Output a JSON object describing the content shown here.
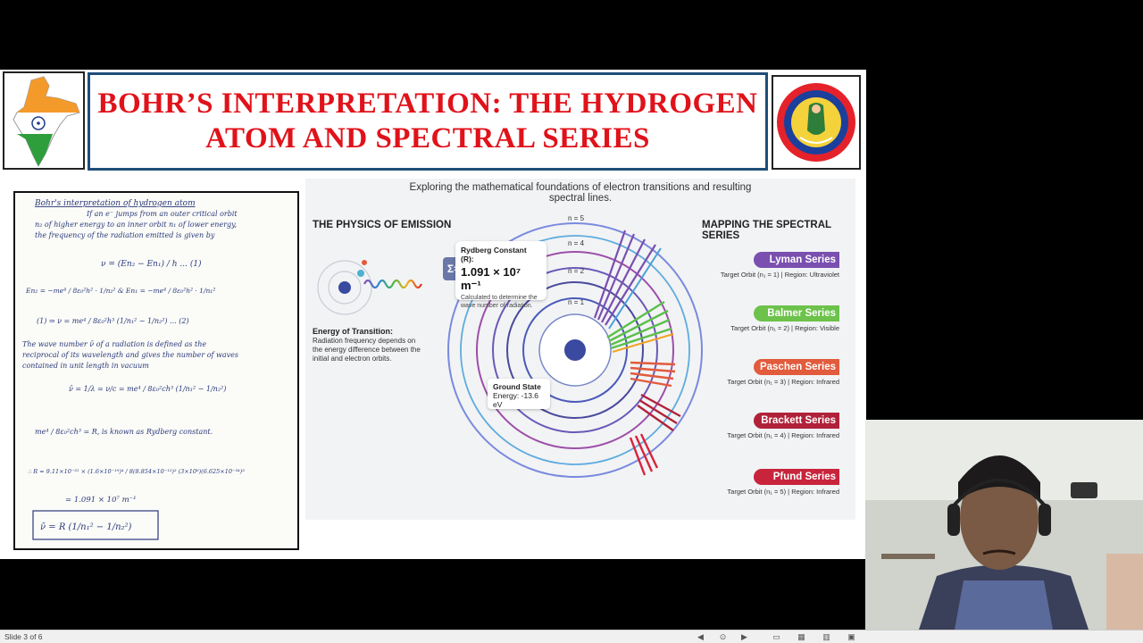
{
  "slide": {
    "title": "BOHR’S INTERPRETATION: THE HYDROGEN ATOM AND SPECTRAL SERIES",
    "title_color": "#e0121a",
    "border_color": "#1f4e79"
  },
  "infographic": {
    "subtitle": "Exploring the mathematical foundations of electron transitions and resulting spectral lines.",
    "physics_title": "THE PHYSICS OF EMISSION",
    "energy_title": "Energy of Transition:",
    "energy_desc": "Radiation frequency depends on the energy difference between the initial and electron orbits.",
    "rydberg_title": "Rydberg Constant (R):",
    "rydberg_value": "1.091 × 10⁷ m⁻¹",
    "rydberg_desc": "Calculated to determine the wave number of radiation.",
    "sigma_symbol": "Σ=",
    "ground_title": "Ground State",
    "ground_energy": "Energy: -13.6 eV",
    "levels": [
      "n = 5",
      "n = 4",
      "n = 2",
      "n = 1"
    ],
    "mapping_title": "MAPPING THE SPECTRAL SERIES",
    "series": [
      {
        "name": "Lyman Series",
        "desc": "Target Orbit (n₁ = 1) | Region: Ultraviolet",
        "color": "#7a4fb0"
      },
      {
        "name": "Balmer Series",
        "desc": "Target Orbit (n₁ = 2) | Region: Visible",
        "color": "#6cc24a"
      },
      {
        "name": "Paschen Series",
        "desc": "Target Orbit (n₁ = 3) | Region: Infrared",
        "color": "#e25b3c"
      },
      {
        "name": "Brackett Series",
        "desc": "Target Orbit (n₁ = 4) | Region: Infrared",
        "color": "#b0223a"
      },
      {
        "name": "Pfund Series",
        "desc": "Target Orbit (n₁ = 5) | Region: Infrared",
        "color": "#c8243c"
      }
    ]
  },
  "notes": {
    "heading": "Bohr's interpretation of hydrogen atom",
    "line1": "If an e⁻ jumps from an outer critical orbit",
    "line2": "n₂ of higher energy to an inner orbit n₁ of lower energy,",
    "line3": "the frequency of the radiation emitted is given by",
    "eq1": "ν = (En₂ − En₁) / h ... (1)",
    "eq2": "En₂ = −me⁴ / 8ε₀²h² · 1/n₂²   &   En₁ = −me⁴ / 8ε₀²h² · 1/n₁²",
    "eq3": "(1) ⇒ ν = me⁴ / 8ε₀²h³ (1/n₁² − 1/n₂²) ... (2)",
    "line4": "The wave number ν̄ of a radiation is defined as the",
    "line5": "reciprocal of its wavelength and gives the number of waves",
    "line6": "contained in unit length in vacuum",
    "eq4": "ν̄ = 1/λ = ν/c = me⁴ / 8ε₀²ch³ (1/n₁² − 1/n₂²)",
    "eq5": "me⁴ / 8ε₀²ch³ = R, is known as Rydberg constant.",
    "eq6": "∴ R = 9.11×10⁻³¹ × (1.6×10⁻¹⁹)⁴ / 8(8.854×10⁻¹²)² (3×10⁸)(6.625×10⁻³⁴)³",
    "eq7": "= 1.091 × 10⁷ m⁻¹",
    "eq8": "ν̄ = R (1/n₁² − 1/n₂²)"
  },
  "statusbar": {
    "slide_indicator": "Slide 3 of 6"
  }
}
